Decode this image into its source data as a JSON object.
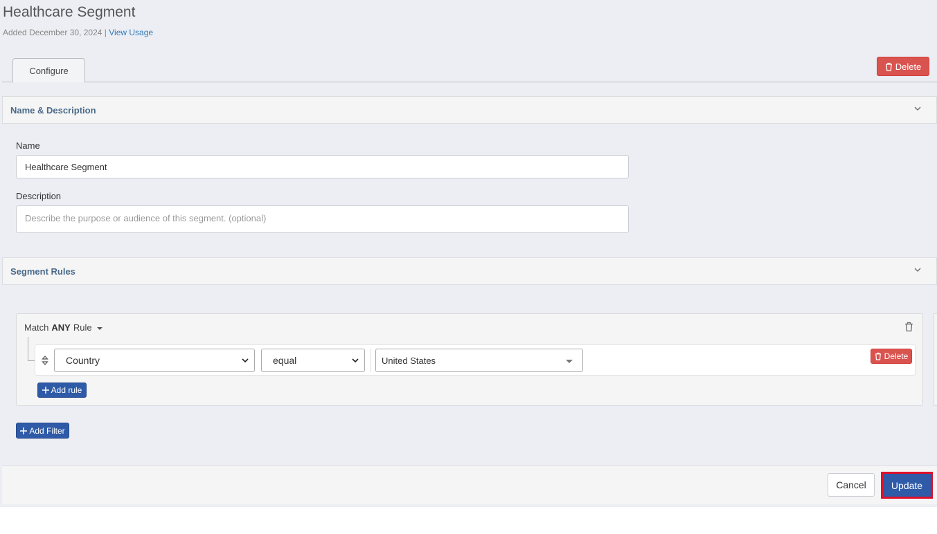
{
  "header": {
    "title": "Healthcare Segment",
    "added_text": "Added December 30, 2024",
    "separator": " | ",
    "view_usage_label": "View Usage"
  },
  "tabs": [
    {
      "label": "Configure",
      "active": true
    }
  ],
  "toolbar": {
    "delete_label": "Delete",
    "delete_icon": "trash-icon",
    "delete_color": "#d9534f"
  },
  "sections": {
    "name_description": {
      "title": "Name & Description",
      "name_label": "Name",
      "name_value": "Healthcare Segment",
      "description_label": "Description",
      "description_placeholder": "Describe the purpose or audience of this segment. (optional)"
    },
    "segment_rules": {
      "title": "Segment Rules",
      "match_prefix": "Match",
      "match_mode": "ANY",
      "match_suffix": "Rule",
      "rules": [
        {
          "field": "Country",
          "operator": "equal",
          "value": "United States",
          "delete_label": "Delete"
        }
      ],
      "add_rule_label": "Add rule",
      "add_filter_label": "Add Filter"
    }
  },
  "footer": {
    "cancel_label": "Cancel",
    "update_label": "Update",
    "primary_color": "#2e5aa8",
    "highlight_color": "#e0102a"
  }
}
